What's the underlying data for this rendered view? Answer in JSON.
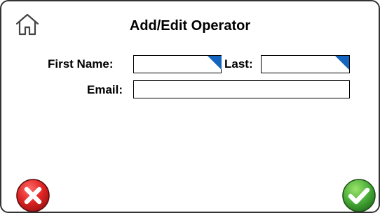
{
  "header": {
    "title": "Add/Edit Operator",
    "home_icon": "home-icon"
  },
  "form": {
    "first_name": {
      "label": "First Name:",
      "value": ""
    },
    "last_name": {
      "label": "Last:",
      "value": ""
    },
    "email": {
      "label": "Email:",
      "value": ""
    }
  },
  "footer": {
    "cancel_icon": "cancel-x-icon",
    "confirm_icon": "confirm-check-icon"
  },
  "colors": {
    "required_marker": "#1565c0",
    "cancel": "#d32f2f",
    "confirm": "#43a047"
  }
}
